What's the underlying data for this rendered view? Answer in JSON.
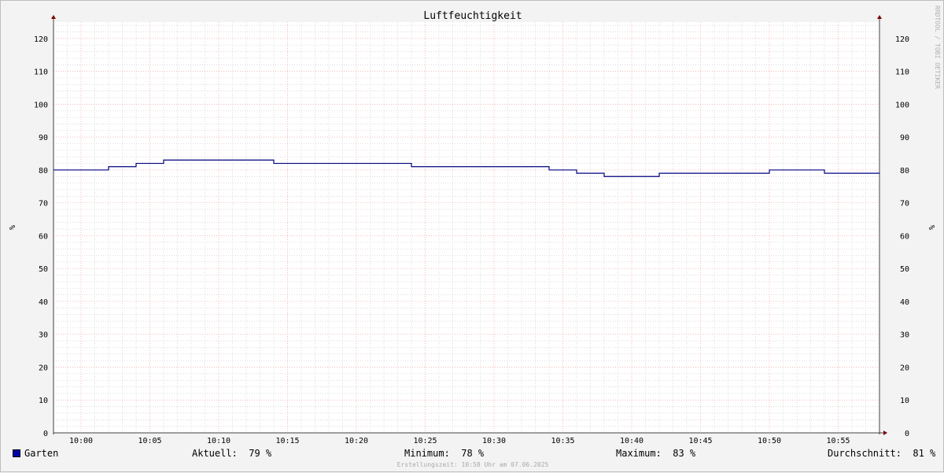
{
  "chart_data": {
    "type": "line",
    "title": "Luftfeuchtigkeit",
    "ylabel": "%",
    "ylabel_right": "%",
    "ylim": [
      0,
      125
    ],
    "y_ticks": [
      0,
      10,
      20,
      30,
      40,
      50,
      60,
      70,
      80,
      90,
      100,
      110,
      120
    ],
    "xlim": [
      "09:58",
      "10:58"
    ],
    "x_ticks": [
      "10:00",
      "10:05",
      "10:10",
      "10:15",
      "10:20",
      "10:25",
      "10:30",
      "10:35",
      "10:40",
      "10:45",
      "10:50",
      "10:55"
    ],
    "grid": true,
    "watermark": "RRDTOOL / TOBI OETIKER",
    "series": [
      {
        "name": "Garten",
        "color": "#000080",
        "step": true,
        "points": [
          [
            "09:58",
            80
          ],
          [
            "10:02",
            81
          ],
          [
            "10:04",
            82
          ],
          [
            "10:06",
            83
          ],
          [
            "10:14",
            82
          ],
          [
            "10:24",
            81
          ],
          [
            "10:34",
            80
          ],
          [
            "10:36",
            79
          ],
          [
            "10:38",
            78
          ],
          [
            "10:42",
            79
          ],
          [
            "10:50",
            80
          ],
          [
            "10:54",
            79
          ],
          [
            "10:58",
            79
          ]
        ]
      }
    ]
  },
  "legend": {
    "series_name": "Garten",
    "series_color": "#0000a8",
    "current": "Aktuell:  79 %",
    "minimum": "Minimum:  78 %",
    "maximum": "Maximum:  83 %",
    "average": "Durchschnitt:  81 %"
  },
  "footer": "Erstellungszeit: 10:58 Uhr am 07.06.2025",
  "colors": {
    "background": "#f3f3f3",
    "canvas": "#ffffff",
    "major_grid": "#f0a0a0",
    "minor_grid": "#c8c8c8",
    "axis": "#404040",
    "arrow": "#800000"
  }
}
